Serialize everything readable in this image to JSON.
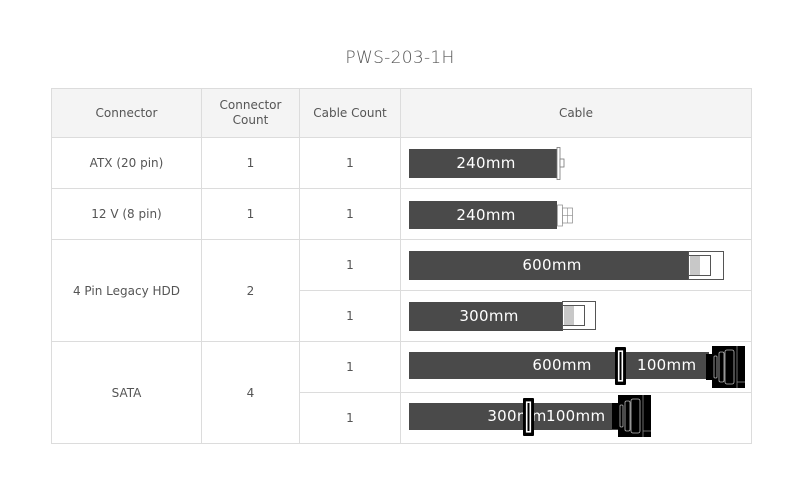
{
  "title": "PWS-203-1H",
  "table": {
    "headers": {
      "connector": "Connector",
      "connector_count": "Connector Count",
      "cable_count": "Cable Count",
      "cable": "Cable"
    },
    "rows": [
      {
        "connector": "ATX (20 pin)",
        "connector_count": "1",
        "cables": [
          {
            "count": "1",
            "lengths": [
              "240mm"
            ],
            "plug": "atx-plug"
          }
        ]
      },
      {
        "connector": "12 V (8 pin)",
        "connector_count": "1",
        "cables": [
          {
            "count": "1",
            "lengths": [
              "240mm"
            ],
            "plug": "eps-plug"
          }
        ]
      },
      {
        "connector": "4 Pin Legacy HDD",
        "connector_count": "2",
        "cables": [
          {
            "count": "1",
            "lengths": [
              "600mm"
            ],
            "plug": "molex-plug"
          },
          {
            "count": "1",
            "lengths": [
              "300mm"
            ],
            "plug": "molex-plug"
          }
        ]
      },
      {
        "connector": "SATA",
        "connector_count": "4",
        "cables": [
          {
            "count": "1",
            "lengths": [
              "600mm",
              "100mm"
            ],
            "plug": "sata-plug"
          },
          {
            "count": "1",
            "lengths": [
              "300mm",
              "100mm"
            ],
            "plug": "sata-plug"
          }
        ]
      }
    ]
  },
  "colors": {
    "wire": "#4a4a4a",
    "border": "#dcdcdc",
    "header_bg": "#f4f4f4"
  }
}
